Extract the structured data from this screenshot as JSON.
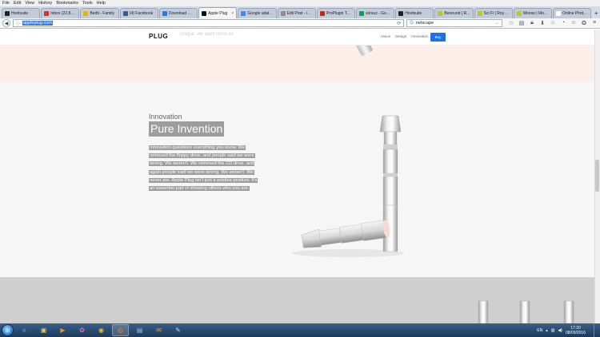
{
  "menu": [
    "File",
    "Edit",
    "View",
    "History",
    "Bookmarks",
    "Tools",
    "Help"
  ],
  "tabs": [
    {
      "label": "Hootsuite",
      "color": "#222222",
      "active": false
    },
    {
      "label": "Inbox (22,800)...",
      "color": "#d93025",
      "active": false
    },
    {
      "label": "Bedti - Family",
      "color": "#e8b400",
      "active": false
    },
    {
      "label": "(4) Facebook",
      "color": "#3b5998",
      "active": false
    },
    {
      "label": "Download Re...",
      "color": "#2a7be4",
      "active": false
    },
    {
      "label": "Apple Plug",
      "color": "#111111",
      "active": true
    },
    {
      "label": "Google adalk...",
      "color": "#4285f4",
      "active": false
    },
    {
      "label": "Edit Post - iPi...",
      "color": "#8c8c8c",
      "active": false
    },
    {
      "label": "ProPlugin Tabl...",
      "color": "#cc2222",
      "active": false
    },
    {
      "label": "sürsuz - Goo...",
      "color": "#0f9d58",
      "active": false
    },
    {
      "label": "Hootsuite",
      "color": "#222222",
      "active": false
    },
    {
      "label": "Benound | R...",
      "color": "#b5c938",
      "active": false
    },
    {
      "label": "Sci Fi | Royalt...",
      "color": "#b5c938",
      "active": false
    },
    {
      "label": "Moose | Mod...",
      "color": "#b5c938",
      "active": false
    },
    {
      "label": "Online Photo Edit...",
      "color": "#ffffff",
      "active": false
    }
  ],
  "nav": {
    "url": "appleplug.com",
    "search_query": "netscape",
    "back_icon": "back-arrow-icon",
    "forward_icon": "forward-arrow-icon"
  },
  "site": {
    "logo_text": "PLUG",
    "ghost_text": "unique. we want more so",
    "nav_links": [
      "Vision",
      "Design",
      "Innovation"
    ],
    "buy_label": "Buy",
    "accent": "#1a73e8"
  },
  "section": {
    "kicker": "Innovation",
    "title": "Pure Invention",
    "body_lines": [
      "Innovation questions everything you know. We",
      "removed the floppy drive, and people said we were",
      "wrong. We weren't. We removed the CD drive, and",
      "again people said we were wrong. We weren't. We",
      "never are. Apple Plug isn't just a pristine product. It's",
      "an essential part of showing others who you are."
    ]
  },
  "taskbar": {
    "apps": [
      {
        "icon": "internet-explorer-icon",
        "glyph": "e",
        "color": "#4aa3f0"
      },
      {
        "icon": "folder-icon",
        "glyph": "▣",
        "color": "#f2c94c"
      },
      {
        "icon": "media-player-icon",
        "glyph": "▶",
        "color": "#f28c28"
      },
      {
        "icon": "paint-icon",
        "glyph": "✿",
        "color": "#e86fd0"
      },
      {
        "icon": "chrome-icon",
        "glyph": "◉",
        "color": "#f4c20d"
      },
      {
        "icon": "firefox-icon",
        "glyph": "◍",
        "color": "#f27418"
      },
      {
        "icon": "remote-desktop-icon",
        "glyph": "▤",
        "color": "#8fc3ef"
      },
      {
        "icon": "outlook-icon",
        "glyph": "✉",
        "color": "#f6a21a"
      },
      {
        "icon": "tools-icon",
        "glyph": "✎",
        "color": "#cfd8e3"
      }
    ],
    "lang": "EN",
    "time": "17:20",
    "date": "08/09/2016"
  }
}
